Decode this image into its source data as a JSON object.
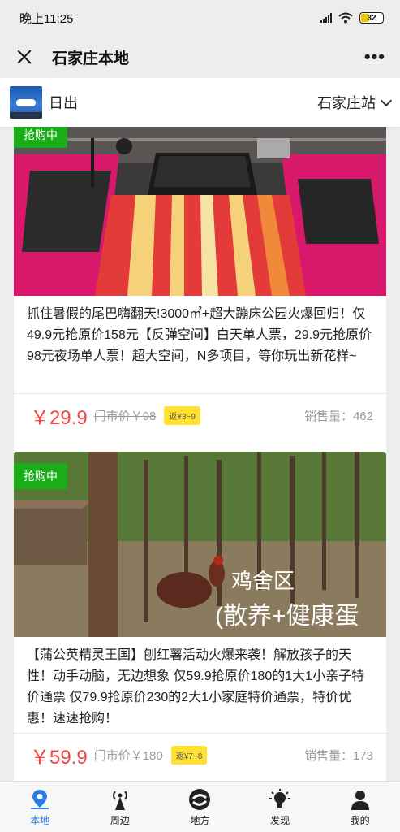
{
  "status_bar": {
    "time": "晚上11:25",
    "battery": "32"
  },
  "nav": {
    "title": "石家庄本地"
  },
  "header": {
    "brand": "日出",
    "station": "石家庄站"
  },
  "cards": [
    {
      "badge": "抢购中",
      "description": "抓住暑假的尾巴嗨翻天!3000㎡+超大蹦床公园火爆回归！仅49.9元抢原价158元【反弹空间】白天单人票，29.9元抢原价98元夜场单人票！超大空间，N多项目，等你玩出新花样~",
      "price": "￥29.9",
      "original_price": "门市价￥98",
      "rebate": "返¥3~9",
      "sales": "销售量：462"
    },
    {
      "badge": "抢购中",
      "image_caption_1": "鸡舍区",
      "image_caption_2": "(散养+健康蛋",
      "description": "【蒲公英精灵王国】刨红薯活动火爆来袭！解放孩子的天性！动手动脑，无边想象 仅59.9抢原价180的1大1小亲子特价通票 仅79.9抢原价230的2大1小家庭特价通票，特价优惠！速速抢购！",
      "price": "￥59.9",
      "original_price": "门市价￥180",
      "rebate": "返¥7~8",
      "sales": "销售量：173"
    }
  ],
  "tabs": [
    {
      "label": "本地",
      "icon": "location-pin-icon",
      "active": true
    },
    {
      "label": "周边",
      "icon": "signal-tower-icon",
      "active": false
    },
    {
      "label": "地方",
      "icon": "swirl-logo-icon",
      "active": false
    },
    {
      "label": "发现",
      "icon": "lightbulb-icon",
      "active": false
    },
    {
      "label": "我的",
      "icon": "person-icon",
      "active": false
    }
  ],
  "colors": {
    "accent": "#2a7de1",
    "badge": "#1aad19",
    "price": "#f04646",
    "rebate": "#ffe033"
  }
}
